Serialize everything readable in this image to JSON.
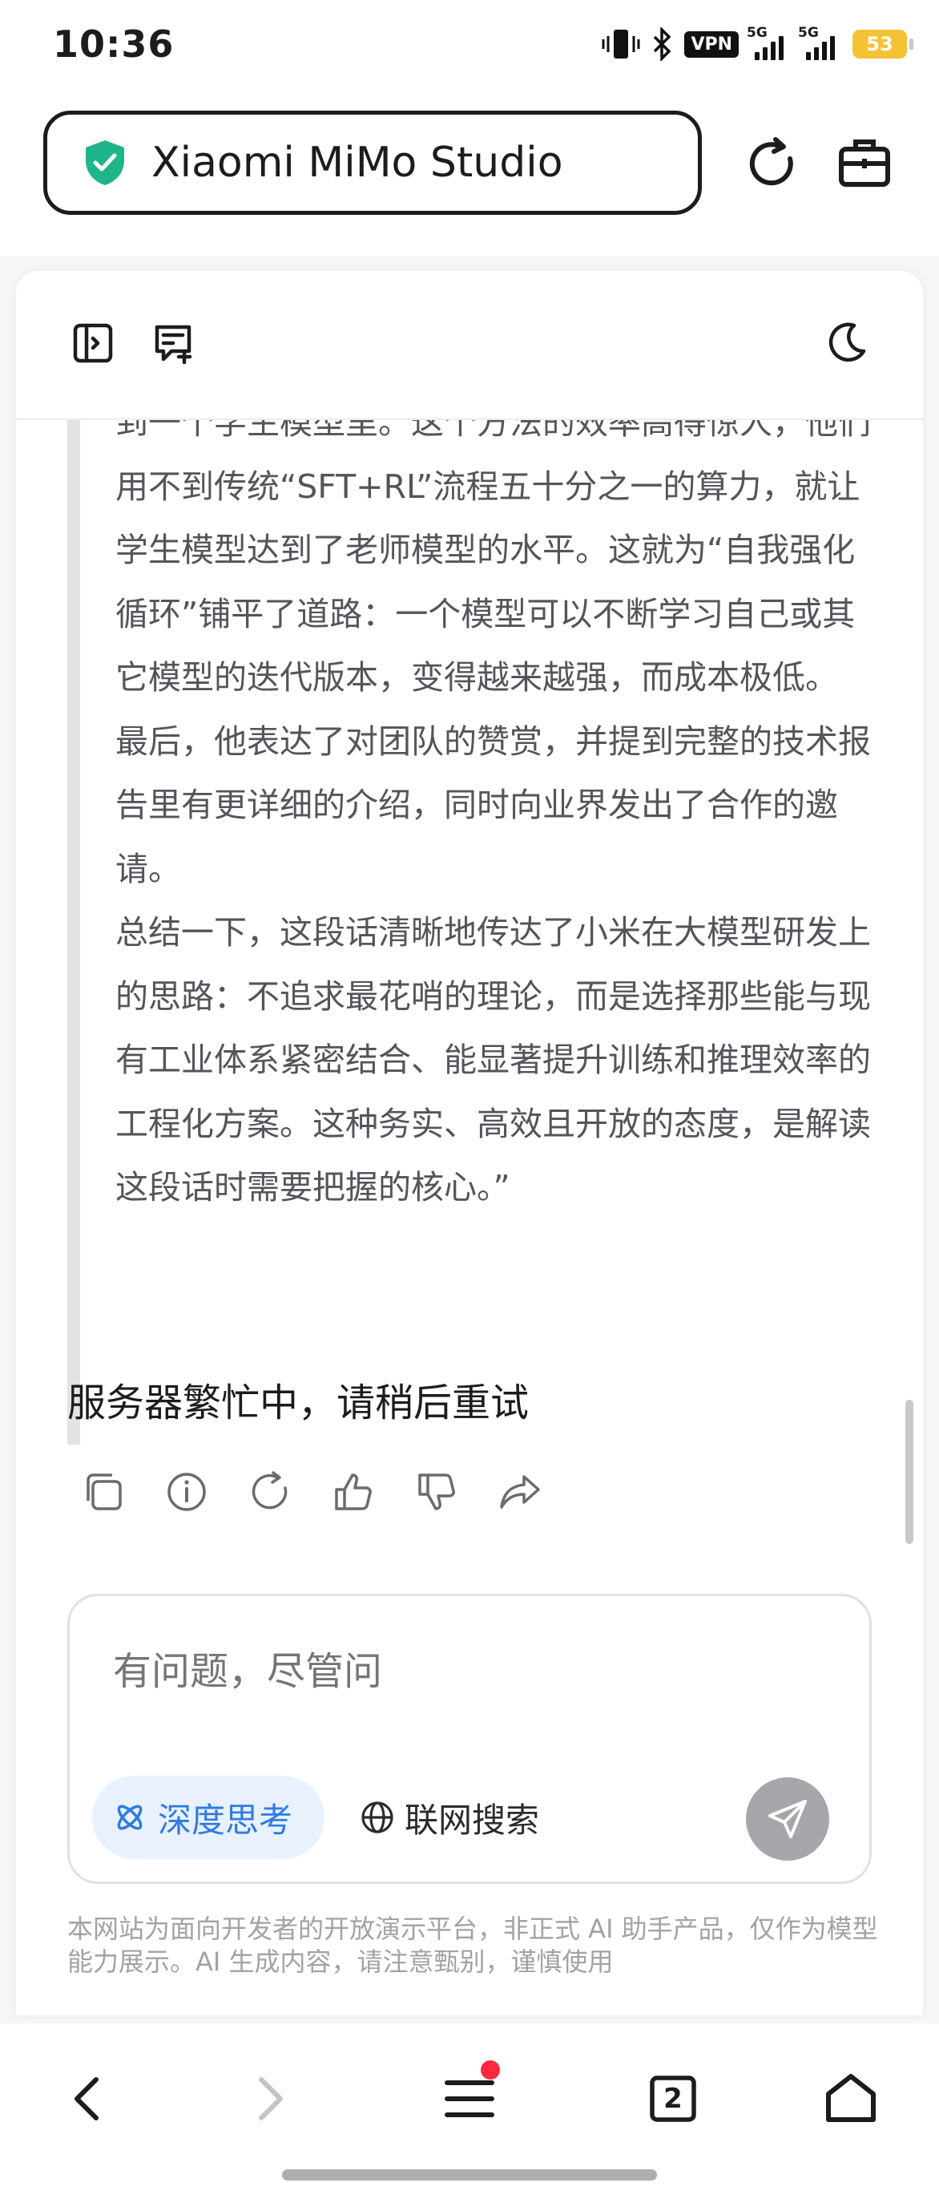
{
  "status_bar": {
    "time": "10:36",
    "vpn": "VPN",
    "net1": "5G",
    "net2": "5G",
    "battery": "53"
  },
  "address_bar": {
    "site_title": "Xiaomi MiMo Studio"
  },
  "colors": {
    "accent_blue": "#2f7be0",
    "shield_green": "#1fb58a",
    "notification_red": "#ff2a3d"
  },
  "content": {
    "paragraphs": [
      "到一个学生模型里。这个方法的效率高得惊人，他们用不到传统“SFT+RL”流程五十分之一的算力，就让学生模型达到了老师模型的水平。这就为“自我强化循环”铺平了道路：一个模型可以不断学习自己或其它模型的迭代版本，变得越来越强，而成本极低。",
      "最后，他表达了对团队的赞赏，并提到完整的技术报告里有更详细的介绍，同时向业界发出了合作的邀请。",
      "总结一下，这段话清晰地传达了小米在大模型研发上的思路：不追求最花哨的理论，而是选择那些能与现有工业体系紧密结合、能显著提升训练和推理效率的工程化方案。这种务实、高效且开放的态度，是解读这段话时需要把握的核心。”"
    ],
    "server_busy": "服务器繁忙中，请稍后重试"
  },
  "input": {
    "placeholder": "有问题，尽管问",
    "deep_think_label": "深度思考",
    "web_search_label": "联网搜索"
  },
  "disclaimer": "本网站为面向开发者的开放演示平台，非正式 AI 助手产品，仅作为模型能力展示。AI 生成内容，请注意甄别，谨慎使用",
  "bottom_nav": {
    "tab_count": "2"
  }
}
